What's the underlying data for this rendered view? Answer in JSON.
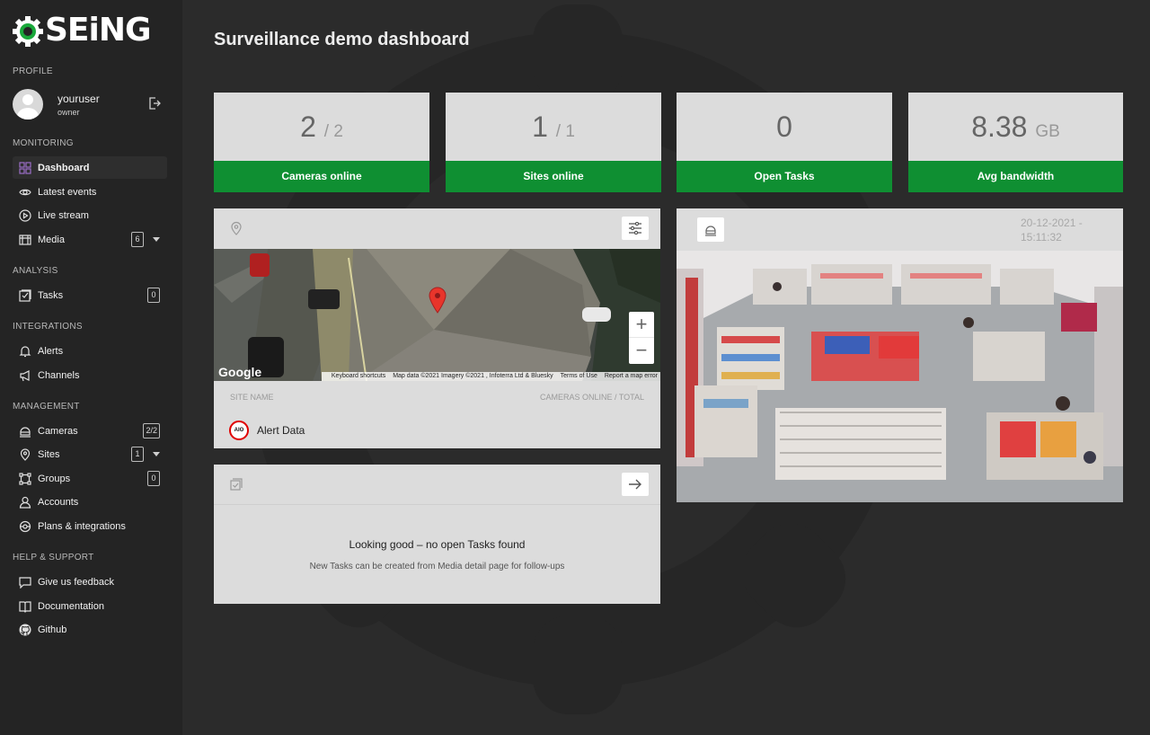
{
  "app": {
    "brand": "SEiNG",
    "page_title": "Surveillance demo dashboard"
  },
  "sidebar": {
    "profile_label": "PROFILE",
    "user_name": "youruser",
    "user_role": "owner",
    "sections": {
      "monitoring": "MONITORING",
      "analysis": "ANALYSIS",
      "integrations": "INTEGRATIONS",
      "management": "MANAGEMENT",
      "help": "HELP & SUPPORT"
    },
    "items": {
      "dashboard": "Dashboard",
      "latest_events": "Latest events",
      "live_stream": "Live stream",
      "media": "Media",
      "media_badge": "6",
      "tasks": "Tasks",
      "tasks_badge": "0",
      "alerts": "Alerts",
      "channels": "Channels",
      "cameras": "Cameras",
      "cameras_badge": "2/2",
      "sites": "Sites",
      "sites_badge": "1",
      "groups": "Groups",
      "groups_badge": "0",
      "accounts": "Accounts",
      "plans": "Plans & integrations",
      "feedback": "Give us feedback",
      "documentation": "Documentation",
      "github": "Github"
    }
  },
  "stats": [
    {
      "value": "2",
      "total": "/ 2",
      "label": "Cameras online"
    },
    {
      "value": "1",
      "total": "/ 1",
      "label": "Sites online"
    },
    {
      "value": "0",
      "total": "",
      "label": "Open Tasks"
    },
    {
      "value": "8.38",
      "total": "GB",
      "label": "Avg bandwidth"
    }
  ],
  "sites_panel": {
    "map_google": "Google",
    "map_shortcuts": "Keyboard shortcuts",
    "map_data": "Map data ©2021 Imagery ©2021 , Infoterra Ltd & Bluesky",
    "map_terms": "Terms of Use",
    "map_report": "Report a map error",
    "zoom_in": "+",
    "zoom_out": "−",
    "col_site_name": "SITE NAME",
    "col_cameras": "CAMERAS ONLINE / TOTAL",
    "site_logo": "AIO",
    "site_name": "Alert Data"
  },
  "tasks_panel": {
    "empty_title": "Looking good – no open Tasks found",
    "empty_subtitle": "New Tasks can be created from Media detail page for follow-ups"
  },
  "camera_panel": {
    "date": "20-12-2021 -",
    "time": "15:11:32"
  },
  "colors": {
    "accent_green": "#0f8f32",
    "sidebar_bg": "#242424",
    "main_bg": "#2b2b2b",
    "card_bg": "#dcdcdc"
  }
}
